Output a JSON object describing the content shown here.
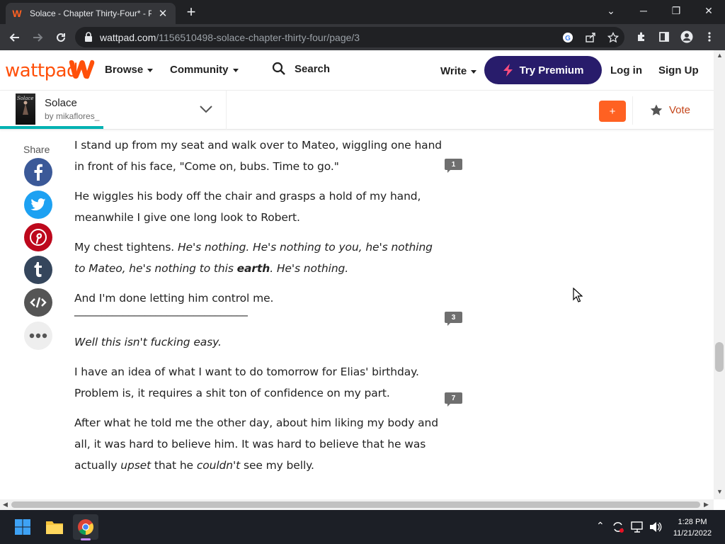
{
  "browser": {
    "tab_title": "Solace - Chapter Thirty-Four* - Pa",
    "tab_close": "✕",
    "new_tab": "+",
    "url_domain": "wattpad.com",
    "url_path": "/1156510498-solace-chapter-thirty-four/page/3",
    "window_controls": {
      "minimize": "─",
      "restore": "❐",
      "close": "✕",
      "dropdown": "⌄"
    }
  },
  "header": {
    "logo": "wattpad",
    "nav": {
      "browse": "Browse",
      "community": "Community"
    },
    "search": "Search",
    "write": "Write",
    "premium": "Try Premium",
    "login": "Log in",
    "signup": "Sign Up"
  },
  "story": {
    "title": "Solace",
    "author": "by mikaflores_",
    "cover_text": "Solace",
    "add_label": "+",
    "vote_label": "Vote",
    "reading_progress": 0.143
  },
  "share": {
    "label": "Share"
  },
  "paragraphs": {
    "p1": "I stand up from my seat and walk over to Mateo, wiggling one hand in front of his face, \"Come on, bubs. Time to go.\"",
    "p2": "He wiggles his body off the chair and grasps a hold of my hand, meanwhile I give one long look to Robert.",
    "p3_a": "My chest tightens. ",
    "p3_b": "He's nothing. He's nothing to you, he's nothing to Mateo, he's nothing to this ",
    "p3_c": "earth",
    "p3_d": ". He's nothing.",
    "p4": "And I'm done letting him control me.",
    "p4_rule": "________________________________",
    "p5": "Well this isn't fucking easy.",
    "p6": "I have an idea of what I want to do tomorrow for Elias' birthday. Problem is, it requires a shit ton of confidence on my part.",
    "p7_a": "After what he told me the other day, about him liking my body and all, it was hard to believe him. It was hard to believe that he was actually ",
    "p7_b": "upset",
    "p7_c": " that he ",
    "p7_d": "couldn't",
    "p7_e": " see my belly."
  },
  "comments": {
    "c1": "1",
    "c2": "3",
    "c3": "7"
  },
  "taskbar": {
    "time": "1:28 PM",
    "date": "11/21/2022"
  },
  "colors": {
    "brand": "#ff500a",
    "premium": "#281c6b",
    "progress": "#00b2b2",
    "vote": "#c4461b"
  }
}
